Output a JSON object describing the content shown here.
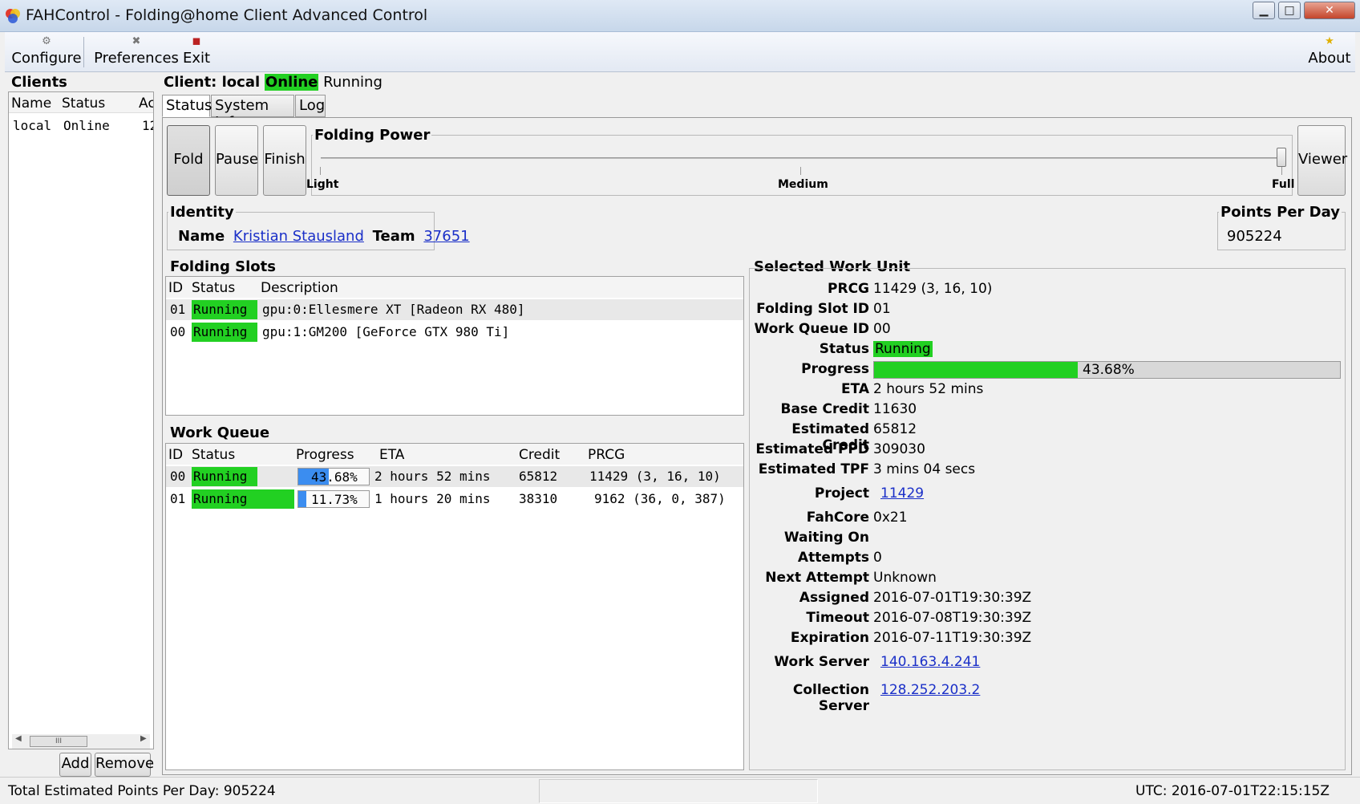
{
  "window": {
    "title": "FAHControl - Folding@home Client Advanced Control",
    "min_glyph": "▁",
    "max_glyph": "□",
    "close_glyph": "✕"
  },
  "toolbar": {
    "configure": "Configure",
    "preferences": "Preferences",
    "exit": "Exit",
    "about": "About"
  },
  "clients": {
    "title": "Clients",
    "headers": [
      "Name",
      "Status",
      "Ac"
    ],
    "rows": [
      [
        "local",
        "Online",
        "12"
      ]
    ],
    "add": "Add",
    "remove": "Remove",
    "scroll_thumb": "III"
  },
  "client_header": {
    "label": "Client: local",
    "online": "Online",
    "running": "Running"
  },
  "tabs": [
    "Status",
    "System Info",
    "Log"
  ],
  "controls": {
    "fold": "Fold",
    "pause": "Pause",
    "finish": "Finish",
    "viewer": "Viewer"
  },
  "folding_power": {
    "title": "Folding Power",
    "light": "Light",
    "medium": "Medium",
    "full": "Full",
    "level": 1.0
  },
  "identity": {
    "title": "Identity",
    "name_label": "Name",
    "name": "Kristian Stausland",
    "team_label": "Team",
    "team": "37651"
  },
  "ppd": {
    "title": "Points Per Day",
    "value": "905224"
  },
  "folding_slots": {
    "title": "Folding Slots",
    "headers": [
      "ID",
      "Status",
      "Description"
    ],
    "rows": [
      {
        "id": "01",
        "status": "Running",
        "desc": "gpu:0:Ellesmere XT [Radeon RX 480]"
      },
      {
        "id": "00",
        "status": "Running",
        "desc": "gpu:1:GM200 [GeForce GTX 980 Ti]"
      }
    ]
  },
  "work_queue": {
    "title": "Work Queue",
    "headers": [
      "ID",
      "Status",
      "Progress",
      "ETA",
      "Credit",
      "PRCG"
    ],
    "rows": [
      {
        "id": "00",
        "status": "Running",
        "progress": "43.68%",
        "progress_frac": 0.4368,
        "eta": "2 hours 52 mins",
        "credit": "65812",
        "prcg": "11429 (3, 16, 10)"
      },
      {
        "id": "01",
        "status": "Running",
        "progress": "11.73%",
        "progress_frac": 0.1173,
        "eta": "1 hours 20 mins",
        "credit": "38310",
        "prcg": "9162 (36, 0, 387)"
      }
    ]
  },
  "selected_work_unit": {
    "title": "Selected Work Unit",
    "progress_frac": 0.4368,
    "fields": [
      {
        "label": "PRCG",
        "value": "11429 (3, 16, 10)"
      },
      {
        "label": "Folding Slot ID",
        "value": "01"
      },
      {
        "label": "Work Queue ID",
        "value": "00"
      },
      {
        "label": "Status",
        "value": "Running"
      },
      {
        "label": "Progress",
        "value": "43.68%"
      },
      {
        "label": "ETA",
        "value": "2 hours 52 mins"
      },
      {
        "label": "Base Credit",
        "value": "11630"
      },
      {
        "label": "Estimated Credit",
        "value": "65812"
      },
      {
        "label": "Estimated PPD",
        "value": "309030"
      },
      {
        "label": "Estimated TPF",
        "value": "3 mins 04 secs"
      },
      {
        "label": "Project",
        "value": "11429"
      },
      {
        "label": "FahCore",
        "value": "0x21"
      },
      {
        "label": "Waiting On",
        "value": ""
      },
      {
        "label": "Attempts",
        "value": "0"
      },
      {
        "label": "Next Attempt",
        "value": "Unknown"
      },
      {
        "label": "Assigned",
        "value": "2016-07-01T19:30:39Z"
      },
      {
        "label": "Timeout",
        "value": "2016-07-08T19:30:39Z"
      },
      {
        "label": "Expiration",
        "value": "2016-07-11T19:30:39Z"
      },
      {
        "label": "Work Server",
        "value": "140.163.4.241"
      },
      {
        "label": "Collection Server",
        "value": "128.252.203.2"
      }
    ]
  },
  "statusbar": {
    "total": "Total Estimated Points Per Day: 905224",
    "utc": "UTC: 2016-07-01T22:15:15Z"
  }
}
